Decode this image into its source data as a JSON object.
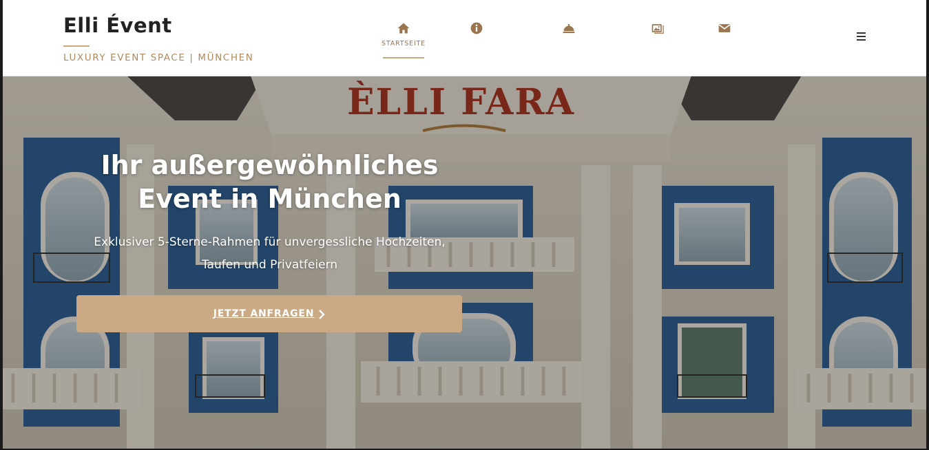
{
  "brand": {
    "title": "Elli Évent",
    "subtitle": "LUXURY EVENT SPACE | MÜNCHEN"
  },
  "nav": {
    "items": [
      {
        "icon": "home-icon",
        "label": "STARTSEITE",
        "active": true
      },
      {
        "icon": "info-icon",
        "label": "",
        "active": false
      },
      {
        "icon": "service-bell-icon",
        "label": "",
        "active": false
      },
      {
        "icon": "gallery-icon",
        "label": "",
        "active": false
      },
      {
        "icon": "envelope-icon",
        "label": "",
        "active": false
      }
    ],
    "menu_icon": "hamburger-icon"
  },
  "hero": {
    "building_sign": "ÈLLI FARA",
    "title": "Ihr außergewöhnliches Event in München",
    "subtitle": "Exklusiver 5-Sterne-Rahmen für unvergessliche Hochzeiten, Taufen und Privatfeiern",
    "cta_label": "JETZT ANFRAGEN",
    "cta_icon": "chevron-right-icon"
  },
  "colors": {
    "accent": "#c9aa84",
    "accent_dark": "#9b7550",
    "header_bg": "#ffffff",
    "facade_blue": "#2a5d94",
    "sign_red": "#a8321e"
  }
}
